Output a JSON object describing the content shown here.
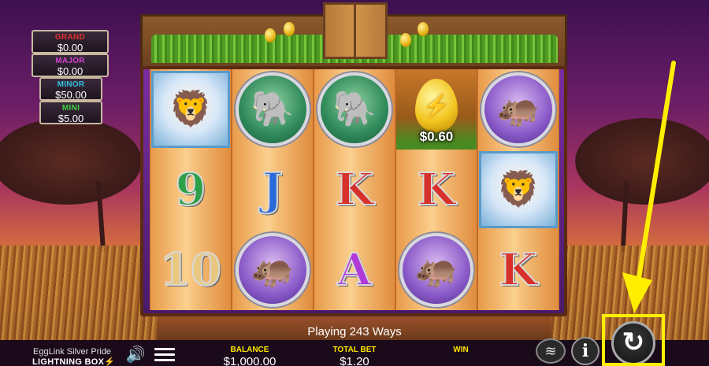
{
  "jackpots": [
    {
      "name": "GRAND",
      "value": "$0.00",
      "color": "#e03030"
    },
    {
      "name": "MAJOR",
      "value": "$0.00",
      "color": "#d040d0"
    },
    {
      "name": "MINOR",
      "value": "$50.00",
      "color": "#30c0e0"
    },
    {
      "name": "MINI",
      "value": "$5.00",
      "color": "#40d040"
    }
  ],
  "reels": {
    "row1": [
      "lion",
      "elephant",
      "elephant",
      "egg",
      "hippo"
    ],
    "row2": [
      "9",
      "J",
      "K",
      "K",
      "lion"
    ],
    "row3": [
      "10",
      "hippo",
      "A",
      "hippo",
      "K"
    ],
    "egg_prize": "$0.60"
  },
  "ways_text": "Playing 243 Ways",
  "footer": {
    "game_name": "EggLink Silver Pride",
    "brand": "LIGHTNING BOX",
    "balance_label": "BALANCE",
    "balance_value": "$1,000.00",
    "total_bet_label": "TOTAL BET",
    "total_bet_value": "$1.20",
    "win_label": "WIN",
    "win_value": ""
  },
  "icons": {
    "speaker": "speaker-icon",
    "menu": "hamburger-menu-icon",
    "coins": "coin-stack-icon",
    "info": "info-icon",
    "spin": "spin-arrow-icon"
  },
  "colors": {
    "highlight": "#ffee00",
    "stat_label": "#ffe600"
  }
}
